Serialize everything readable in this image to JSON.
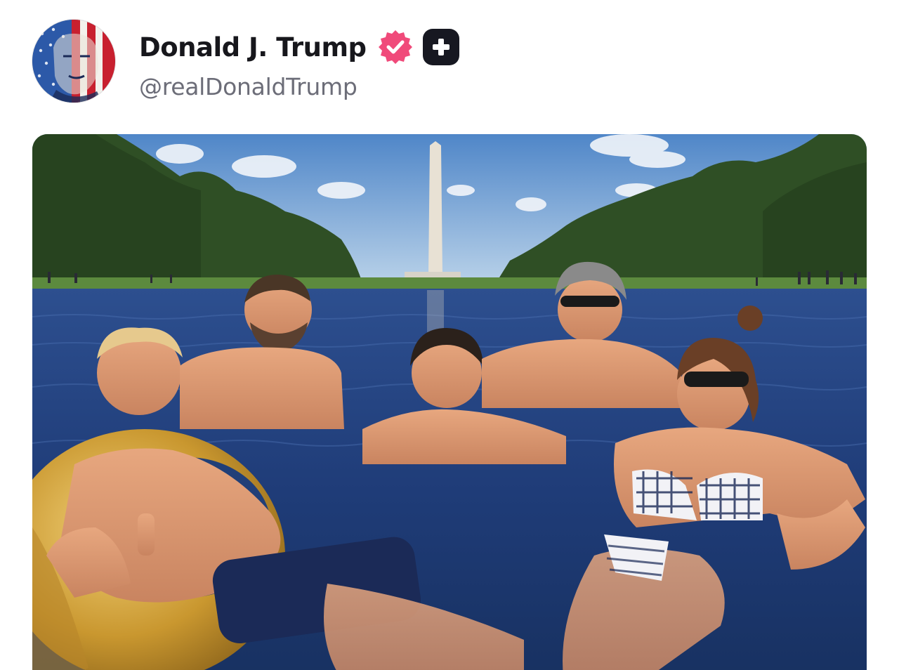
{
  "post": {
    "author": {
      "display_name": "Donald J. Trump",
      "handle": "@realDonaldTrump",
      "verified": true,
      "verified_badge_color": "#f04a7a",
      "plus_badge_color": "#171821"
    },
    "media": {
      "type": "image",
      "icon": "photo"
    }
  },
  "colors": {
    "name_text": "#17171c",
    "handle_text": "#6c6d78",
    "background": "#ffffff"
  }
}
